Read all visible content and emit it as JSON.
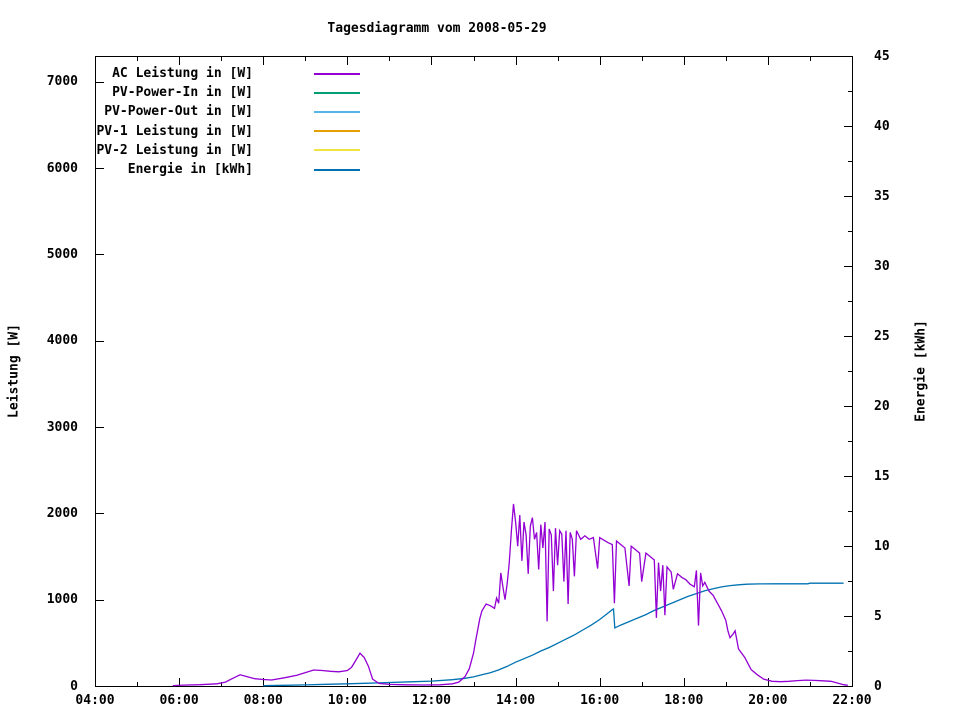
{
  "chart_data": {
    "type": "line",
    "title": "Tagesdiagramm vom 2008-05-29",
    "grid": false,
    "legend_position": "top-left",
    "x_axis": {
      "min": 4,
      "max": 22,
      "minor_step": 1,
      "ticks": [
        {
          "v": 4,
          "label": "04:00"
        },
        {
          "v": 6,
          "label": "06:00"
        },
        {
          "v": 8,
          "label": "08:00"
        },
        {
          "v": 10,
          "label": "10:00"
        },
        {
          "v": 12,
          "label": "12:00"
        },
        {
          "v": 14,
          "label": "14:00"
        },
        {
          "v": 16,
          "label": "16:00"
        },
        {
          "v": 18,
          "label": "18:00"
        },
        {
          "v": 20,
          "label": "20:00"
        },
        {
          "v": 22,
          "label": "22:00"
        }
      ]
    },
    "y_left": {
      "label": "Leistung [W]",
      "min": 0,
      "max": 7300,
      "ticks": [
        {
          "v": 0,
          "label": "0"
        },
        {
          "v": 1000,
          "label": "1000"
        },
        {
          "v": 2000,
          "label": "2000"
        },
        {
          "v": 3000,
          "label": "3000"
        },
        {
          "v": 4000,
          "label": "4000"
        },
        {
          "v": 5000,
          "label": "5000"
        },
        {
          "v": 6000,
          "label": "6000"
        },
        {
          "v": 7000,
          "label": "7000"
        }
      ]
    },
    "y_right": {
      "label": "Energie [kWh]",
      "min": 0,
      "max": 45,
      "minor_step": 2.5,
      "ticks": [
        {
          "v": 0,
          "label": "0"
        },
        {
          "v": 5,
          "label": "5"
        },
        {
          "v": 10,
          "label": "10"
        },
        {
          "v": 15,
          "label": "15"
        },
        {
          "v": 20,
          "label": "20"
        },
        {
          "v": 25,
          "label": "25"
        },
        {
          "v": 30,
          "label": "30"
        },
        {
          "v": 35,
          "label": "35"
        },
        {
          "v": 40,
          "label": "40"
        },
        {
          "v": 45,
          "label": "45"
        }
      ]
    },
    "legend": [
      {
        "label": "AC Leistung in [W]",
        "color": "#9400d3"
      },
      {
        "label": "PV-Power-In in [W]",
        "color": "#009e73"
      },
      {
        "label": "PV-Power-Out in [W]",
        "color": "#56b4e9"
      },
      {
        "label": "PV-1 Leistung in [W]",
        "color": "#e69f00"
      },
      {
        "label": "PV-2 Leistung in [W]",
        "color": "#f0e442"
      },
      {
        "label": "Energie in [kWh]",
        "color": "#0072b2"
      }
    ],
    "series": [
      {
        "id": "ac",
        "name": "AC Leistung in [W]",
        "color": "#9400d3",
        "axis": "left",
        "points": [
          [
            5.85,
            5
          ],
          [
            6.1,
            10
          ],
          [
            6.5,
            15
          ],
          [
            6.9,
            25
          ],
          [
            7.1,
            45
          ],
          [
            7.3,
            95
          ],
          [
            7.45,
            130
          ],
          [
            7.6,
            110
          ],
          [
            7.8,
            85
          ],
          [
            8.0,
            75
          ],
          [
            8.2,
            70
          ],
          [
            8.5,
            95
          ],
          [
            8.8,
            125
          ],
          [
            9.0,
            155
          ],
          [
            9.2,
            185
          ],
          [
            9.4,
            180
          ],
          [
            9.6,
            170
          ],
          [
            9.8,
            165
          ],
          [
            10.0,
            180
          ],
          [
            10.1,
            215
          ],
          [
            10.2,
            295
          ],
          [
            10.3,
            380
          ],
          [
            10.4,
            330
          ],
          [
            10.5,
            230
          ],
          [
            10.6,
            80
          ],
          [
            10.75,
            30
          ],
          [
            11.0,
            18
          ],
          [
            11.4,
            14
          ],
          [
            11.8,
            12
          ],
          [
            12.2,
            14
          ],
          [
            12.5,
            25
          ],
          [
            12.65,
            45
          ],
          [
            12.8,
            110
          ],
          [
            12.9,
            200
          ],
          [
            13.0,
            380
          ],
          [
            13.05,
            520
          ],
          [
            13.1,
            650
          ],
          [
            13.15,
            780
          ],
          [
            13.2,
            870
          ],
          [
            13.3,
            950
          ],
          [
            13.4,
            930
          ],
          [
            13.5,
            900
          ],
          [
            13.55,
            1020
          ],
          [
            13.6,
            960
          ],
          [
            13.65,
            1310
          ],
          [
            13.7,
            1150
          ],
          [
            13.75,
            1000
          ],
          [
            13.8,
            1180
          ],
          [
            13.85,
            1420
          ],
          [
            13.9,
            1800
          ],
          [
            13.95,
            2110
          ],
          [
            14.0,
            1900
          ],
          [
            14.05,
            1620
          ],
          [
            14.1,
            1980
          ],
          [
            14.15,
            1450
          ],
          [
            14.2,
            1900
          ],
          [
            14.25,
            1750
          ],
          [
            14.3,
            1300
          ],
          [
            14.35,
            1850
          ],
          [
            14.4,
            1950
          ],
          [
            14.45,
            1700
          ],
          [
            14.5,
            1780
          ],
          [
            14.55,
            1350
          ],
          [
            14.6,
            1870
          ],
          [
            14.65,
            1600
          ],
          [
            14.7,
            1900
          ],
          [
            14.75,
            750
          ],
          [
            14.8,
            1820
          ],
          [
            14.85,
            1750
          ],
          [
            14.9,
            1100
          ],
          [
            14.95,
            1830
          ],
          [
            15.0,
            1400
          ],
          [
            15.05,
            1800
          ],
          [
            15.1,
            1760
          ],
          [
            15.15,
            1210
          ],
          [
            15.2,
            1800
          ],
          [
            15.25,
            950
          ],
          [
            15.3,
            1780
          ],
          [
            15.35,
            1700
          ],
          [
            15.4,
            1270
          ],
          [
            15.45,
            1800
          ],
          [
            15.5,
            1750
          ],
          [
            15.55,
            1700
          ],
          [
            15.65,
            1740
          ],
          [
            15.75,
            1700
          ],
          [
            15.85,
            1720
          ],
          [
            15.95,
            1360
          ],
          [
            16.0,
            1720
          ],
          [
            16.1,
            1690
          ],
          [
            16.2,
            1660
          ],
          [
            16.3,
            1640
          ],
          [
            16.35,
            960
          ],
          [
            16.4,
            1680
          ],
          [
            16.5,
            1640
          ],
          [
            16.6,
            1600
          ],
          [
            16.7,
            1160
          ],
          [
            16.75,
            1620
          ],
          [
            16.85,
            1580
          ],
          [
            16.95,
            1540
          ],
          [
            17.0,
            1210
          ],
          [
            17.1,
            1540
          ],
          [
            17.2,
            1500
          ],
          [
            17.3,
            1460
          ],
          [
            17.35,
            790
          ],
          [
            17.4,
            1430
          ],
          [
            17.45,
            1100
          ],
          [
            17.5,
            1400
          ],
          [
            17.55,
            820
          ],
          [
            17.6,
            1380
          ],
          [
            17.7,
            1320
          ],
          [
            17.75,
            1120
          ],
          [
            17.85,
            1300
          ],
          [
            17.95,
            1260
          ],
          [
            18.05,
            1230
          ],
          [
            18.15,
            1180
          ],
          [
            18.25,
            1150
          ],
          [
            18.3,
            1340
          ],
          [
            18.35,
            700
          ],
          [
            18.4,
            1310
          ],
          [
            18.45,
            1160
          ],
          [
            18.5,
            1200
          ],
          [
            18.55,
            1150
          ],
          [
            18.6,
            1100
          ],
          [
            18.7,
            1050
          ],
          [
            18.8,
            960
          ],
          [
            18.9,
            870
          ],
          [
            19.0,
            760
          ],
          [
            19.05,
            640
          ],
          [
            19.1,
            560
          ],
          [
            19.17,
            600
          ],
          [
            19.22,
            640
          ],
          [
            19.3,
            430
          ],
          [
            19.45,
            330
          ],
          [
            19.6,
            190
          ],
          [
            19.75,
            130
          ],
          [
            19.9,
            80
          ],
          [
            20.1,
            55
          ],
          [
            20.3,
            50
          ],
          [
            20.5,
            55
          ],
          [
            20.7,
            62
          ],
          [
            20.9,
            68
          ],
          [
            21.1,
            65
          ],
          [
            21.3,
            60
          ],
          [
            21.5,
            55
          ],
          [
            21.65,
            35
          ],
          [
            21.8,
            15
          ],
          [
            21.9,
            8
          ]
        ]
      },
      {
        "id": "pv_in",
        "name": "PV-Power-In in [W]",
        "color": "#009e73",
        "axis": "left",
        "points": []
      },
      {
        "id": "pv_out",
        "name": "PV-Power-Out in [W]",
        "color": "#56b4e9",
        "axis": "left",
        "points": []
      },
      {
        "id": "pv1",
        "name": "PV-1 Leistung in [W]",
        "color": "#e69f00",
        "axis": "left",
        "points": []
      },
      {
        "id": "pv2",
        "name": "PV-2 Leistung in [W]",
        "color": "#f0e442",
        "axis": "left",
        "points": []
      },
      {
        "id": "energie",
        "name": "Energie in [kWh]",
        "color": "#0072b2",
        "axis": "right",
        "points": [
          [
            8.0,
            0.02
          ],
          [
            8.5,
            0.05
          ],
          [
            9.0,
            0.08
          ],
          [
            9.5,
            0.12
          ],
          [
            10.0,
            0.16
          ],
          [
            10.5,
            0.2
          ],
          [
            11.0,
            0.25
          ],
          [
            11.5,
            0.3
          ],
          [
            12.0,
            0.35
          ],
          [
            12.5,
            0.45
          ],
          [
            12.8,
            0.55
          ],
          [
            13.0,
            0.65
          ],
          [
            13.2,
            0.8
          ],
          [
            13.4,
            0.95
          ],
          [
            13.6,
            1.15
          ],
          [
            13.8,
            1.4
          ],
          [
            14.0,
            1.7
          ],
          [
            14.2,
            1.95
          ],
          [
            14.4,
            2.2
          ],
          [
            14.6,
            2.5
          ],
          [
            14.8,
            2.75
          ],
          [
            15.0,
            3.05
          ],
          [
            15.2,
            3.35
          ],
          [
            15.4,
            3.65
          ],
          [
            15.6,
            4.0
          ],
          [
            15.8,
            4.35
          ],
          [
            16.0,
            4.75
          ],
          [
            16.15,
            5.1
          ],
          [
            16.3,
            5.45
          ],
          [
            16.33,
            5.5
          ],
          [
            16.36,
            4.15
          ],
          [
            16.5,
            4.35
          ],
          [
            16.7,
            4.6
          ],
          [
            16.9,
            4.85
          ],
          [
            17.1,
            5.1
          ],
          [
            17.3,
            5.4
          ],
          [
            17.5,
            5.65
          ],
          [
            17.7,
            5.9
          ],
          [
            17.9,
            6.15
          ],
          [
            18.1,
            6.4
          ],
          [
            18.3,
            6.6
          ],
          [
            18.5,
            6.8
          ],
          [
            18.7,
            6.95
          ],
          [
            18.9,
            7.08
          ],
          [
            19.1,
            7.17
          ],
          [
            19.3,
            7.23
          ],
          [
            19.5,
            7.27
          ],
          [
            19.8,
            7.29
          ],
          [
            20.2,
            7.3
          ],
          [
            20.6,
            7.3
          ],
          [
            20.95,
            7.3
          ],
          [
            21.0,
            7.34
          ],
          [
            21.4,
            7.34
          ],
          [
            21.8,
            7.34
          ]
        ]
      }
    ]
  }
}
